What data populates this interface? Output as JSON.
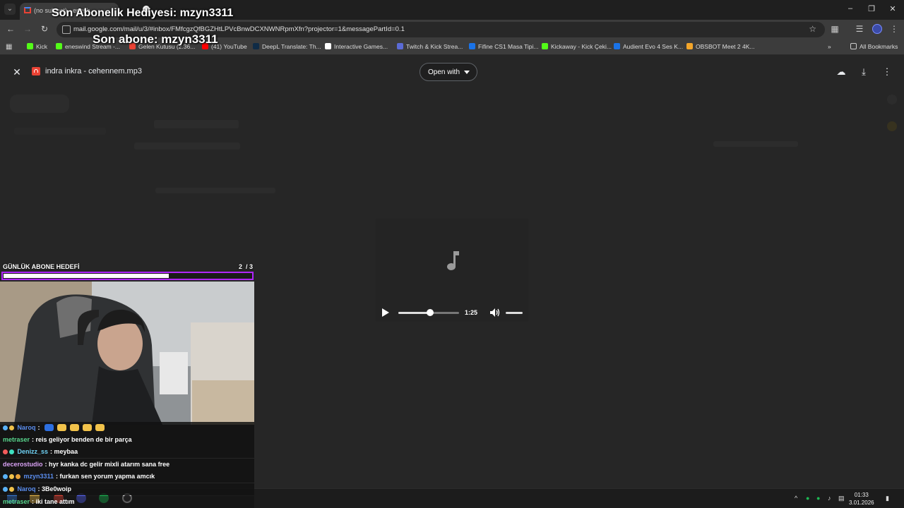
{
  "overlay": {
    "last_gift": "Son Abonelik Hediyesi: mzyn3311",
    "last_sub": "Son abone: mzyn3311"
  },
  "browser": {
    "tab_title": "(no subject) - enesh...",
    "url": "mail.google.com/mail/u/3/#inbox/FMfcgzQfBGZHtLPVcBnwDCXNWNRpmXfn?projector=1&messagePartId=0.1",
    "bookmarks": [
      {
        "label": "Kick",
        "color": "#53fc18"
      },
      {
        "label": "eneswind Stream -...",
        "color": "#53fc18"
      },
      {
        "label": "Gelen Kutusu (2.36...",
        "color": "#ea4335"
      },
      {
        "label": "(41) YouTube",
        "color": "#ff0000"
      },
      {
        "label": "DeepL Translate: Th...",
        "color": "#0f2b46"
      },
      {
        "label": "Interactive Games...",
        "color": "#ffffff"
      },
      {
        "label": "Twitch & Kick Strea...",
        "color": "#5b6bd6"
      },
      {
        "label": "Fifine CS1 Masa Tipi...",
        "color": "#1a73e8"
      },
      {
        "label": "Kickaway - Kick Çeki...",
        "color": "#53fc18"
      },
      {
        "label": "Audient Evo 4 Ses K...",
        "color": "#1a73e8"
      },
      {
        "label": "OBSBOT Meet 2 4K...",
        "color": "#f4a62a"
      }
    ],
    "all_bookmarks": "All Bookmarks"
  },
  "viewer": {
    "file_name": "indra inkra - cehennem.mp3",
    "open_with": "Open with",
    "player": {
      "time": "1:25",
      "progress": 0.52,
      "volume": 1.0
    }
  },
  "goal": {
    "label": "GÜNLÜK ABONE HEDEFİ",
    "current": "2",
    "target": "/ 3",
    "progress": 0.6667
  },
  "chat": [
    {
      "user": "Naroq",
      "color": "#5a8dee",
      "text": "",
      "emotes": 5
    },
    {
      "user": "metraser",
      "color": "#58d68d",
      "text": "reis geliyor benden de bir parça",
      "emotes": 0
    },
    {
      "user": "Denizz_ss",
      "color": "#6fd3f5",
      "text": "meybaa",
      "emotes": 0
    },
    {
      "user": "decerostudio",
      "color": "#d9a2f5",
      "text": "hyr kanka dc gelir mixli atarım sana free",
      "emotes": 0
    },
    {
      "user": "mzyn3311",
      "color": "#5a8dee",
      "text": "furkan sen yorum yapma amcık",
      "emotes": 0
    },
    {
      "user": "Naroq",
      "color": "#5a8dee",
      "text": "3Be0woip",
      "emotes": 0
    },
    {
      "user": "metraser",
      "color": "#58d68d",
      "text": "iki tane attım",
      "emotes": 0
    }
  ],
  "taskbar": {
    "time": "01:33",
    "date": "3.01.2026"
  }
}
